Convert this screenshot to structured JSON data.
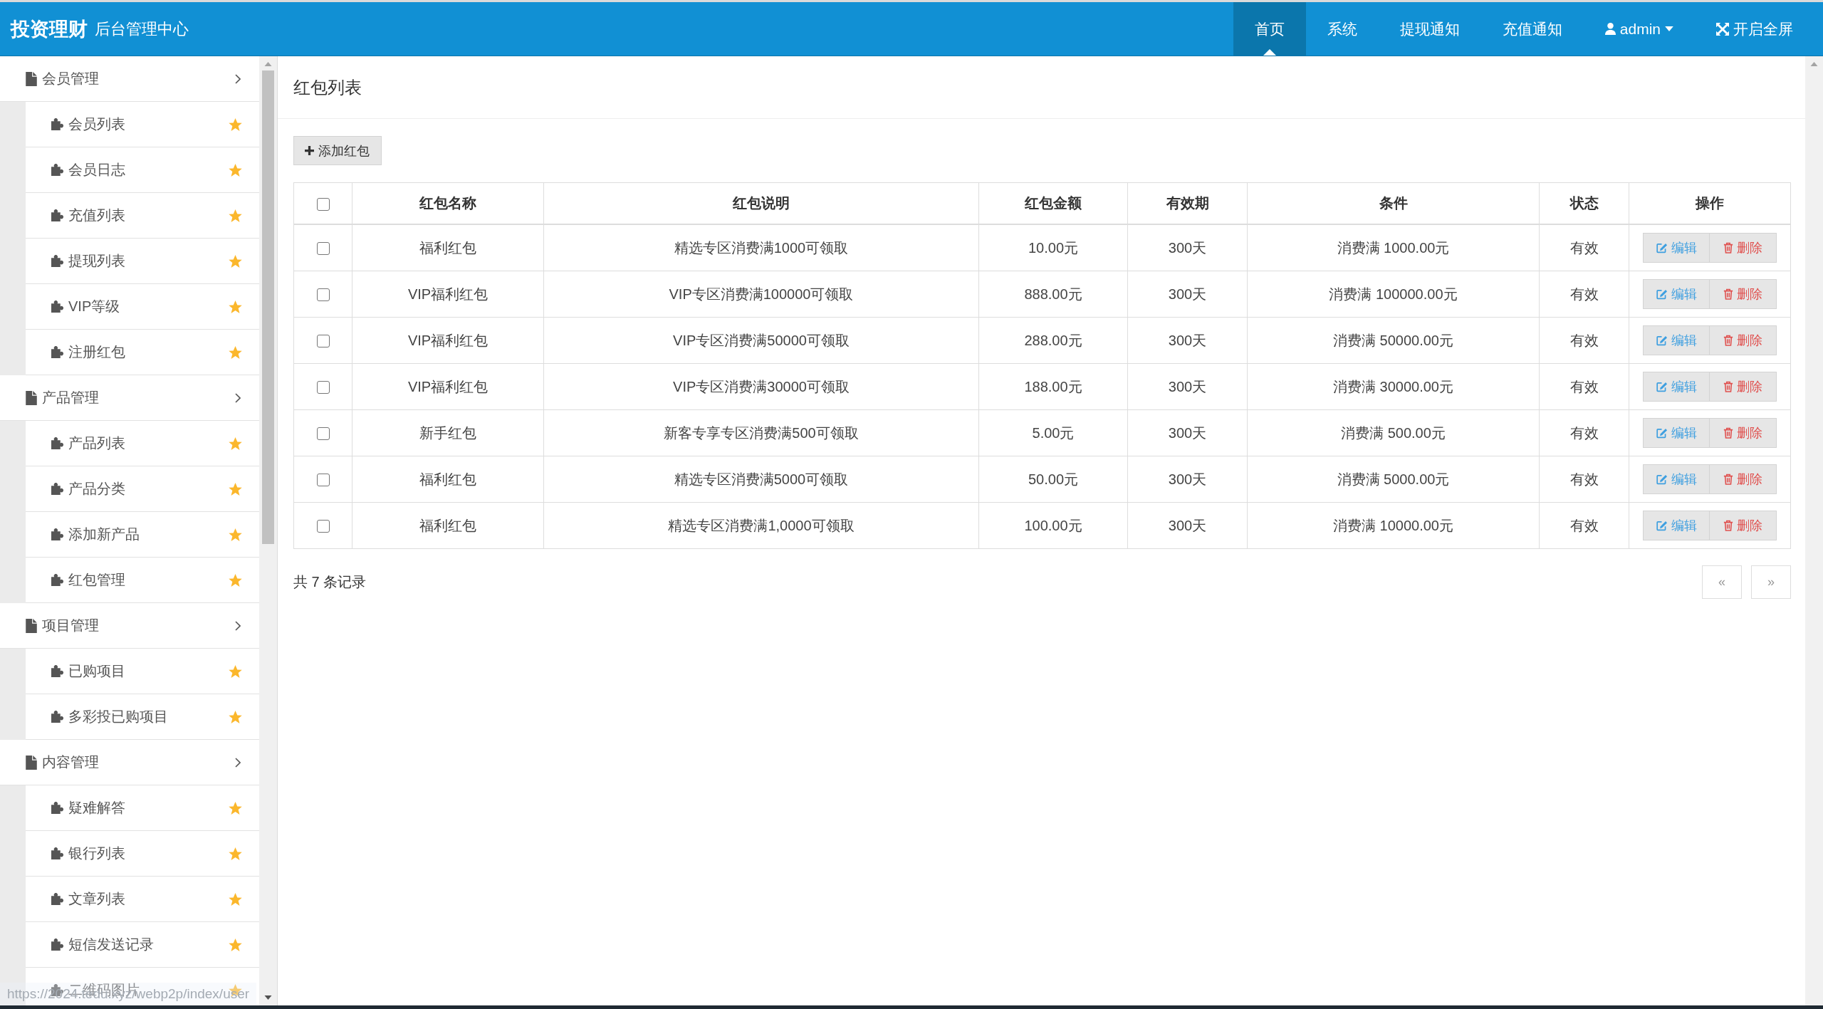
{
  "header": {
    "brand": "投资理财",
    "subtitle": "后台管理中心",
    "nav": [
      {
        "label": "首页",
        "kind": "link",
        "selected": true
      },
      {
        "label": "系统",
        "kind": "link",
        "selected": false
      },
      {
        "label": "提现通知",
        "kind": "link",
        "selected": false
      },
      {
        "label": "充值通知",
        "kind": "link",
        "selected": false
      },
      {
        "label": "admin",
        "kind": "user",
        "selected": false
      },
      {
        "label": "开启全屏",
        "kind": "fullscreen",
        "selected": false
      }
    ]
  },
  "sidebar": {
    "groups": [
      {
        "label": "会员管理",
        "children": [
          {
            "label": "会员列表"
          },
          {
            "label": "会员日志"
          },
          {
            "label": "充值列表"
          },
          {
            "label": "提现列表"
          },
          {
            "label": "VIP等级"
          },
          {
            "label": "注册红包"
          }
        ]
      },
      {
        "label": "产品管理",
        "children": [
          {
            "label": "产品列表"
          },
          {
            "label": "产品分类"
          },
          {
            "label": "添加新产品"
          },
          {
            "label": "红包管理"
          }
        ]
      },
      {
        "label": "项目管理",
        "children": [
          {
            "label": "已购项目"
          },
          {
            "label": "多彩投已购项目"
          }
        ]
      },
      {
        "label": "内容管理",
        "children": [
          {
            "label": "疑难解答"
          },
          {
            "label": "银行列表"
          },
          {
            "label": "文章列表"
          },
          {
            "label": "短信发送记录"
          },
          {
            "label": "二维码图片"
          }
        ]
      }
    ]
  },
  "page": {
    "title": "红包列表",
    "add_button": "添加红包",
    "table": {
      "select_all": {
        "checked": false
      },
      "columns": [
        "红包名称",
        "红包说明",
        "红包金额",
        "有效期",
        "条件",
        "状态",
        "操作"
      ],
      "rows": [
        {
          "checked": false,
          "cells": [
            "福利红包",
            "精选专区消费满1000可领取",
            "10.00元",
            "300天",
            "消费满 1000.00元",
            "有效"
          ],
          "actions": [
            {
              "kind": "edit",
              "label": "编辑"
            },
            {
              "kind": "delete",
              "label": "删除"
            }
          ]
        },
        {
          "checked": false,
          "cells": [
            "VIP福利红包",
            "VIP专区消费满100000可领取",
            "888.00元",
            "300天",
            "消费满 100000.00元",
            "有效"
          ],
          "actions": [
            {
              "kind": "edit",
              "label": "编辑"
            },
            {
              "kind": "delete",
              "label": "删除"
            }
          ]
        },
        {
          "checked": false,
          "cells": [
            "VIP福利红包",
            "VIP专区消费满50000可领取",
            "288.00元",
            "300天",
            "消费满 50000.00元",
            "有效"
          ],
          "actions": [
            {
              "kind": "edit",
              "label": "编辑"
            },
            {
              "kind": "delete",
              "label": "删除"
            }
          ]
        },
        {
          "checked": false,
          "cells": [
            "VIP福利红包",
            "VIP专区消费满30000可领取",
            "188.00元",
            "300天",
            "消费满 30000.00元",
            "有效"
          ],
          "actions": [
            {
              "kind": "edit",
              "label": "编辑"
            },
            {
              "kind": "delete",
              "label": "删除"
            }
          ]
        },
        {
          "checked": false,
          "cells": [
            "新手红包",
            "新客专享专区消费满500可领取",
            "5.00元",
            "300天",
            "消费满 500.00元",
            "有效"
          ],
          "actions": [
            {
              "kind": "edit",
              "label": "编辑"
            },
            {
              "kind": "delete",
              "label": "删除"
            }
          ]
        },
        {
          "checked": false,
          "cells": [
            "福利红包",
            "精选专区消费满5000可领取",
            "50.00元",
            "300天",
            "消费满 5000.00元",
            "有效"
          ],
          "actions": [
            {
              "kind": "edit",
              "label": "编辑"
            },
            {
              "kind": "delete",
              "label": "删除"
            }
          ]
        },
        {
          "checked": false,
          "cells": [
            "福利红包",
            "精选专区消费满1,0000可领取",
            "100.00元",
            "300天",
            "消费满 10000.00元",
            "有效"
          ],
          "actions": [
            {
              "kind": "edit",
              "label": "编辑"
            },
            {
              "kind": "delete",
              "label": "删除"
            }
          ]
        }
      ]
    },
    "record_count": "共 7 条记录",
    "pagination": [
      {
        "label": "«",
        "disabled": true
      },
      {
        "label": "»",
        "disabled": true
      }
    ]
  },
  "status_bubble": {
    "url": "https://2024.tedu.xyz/webp2p/index/user"
  }
}
